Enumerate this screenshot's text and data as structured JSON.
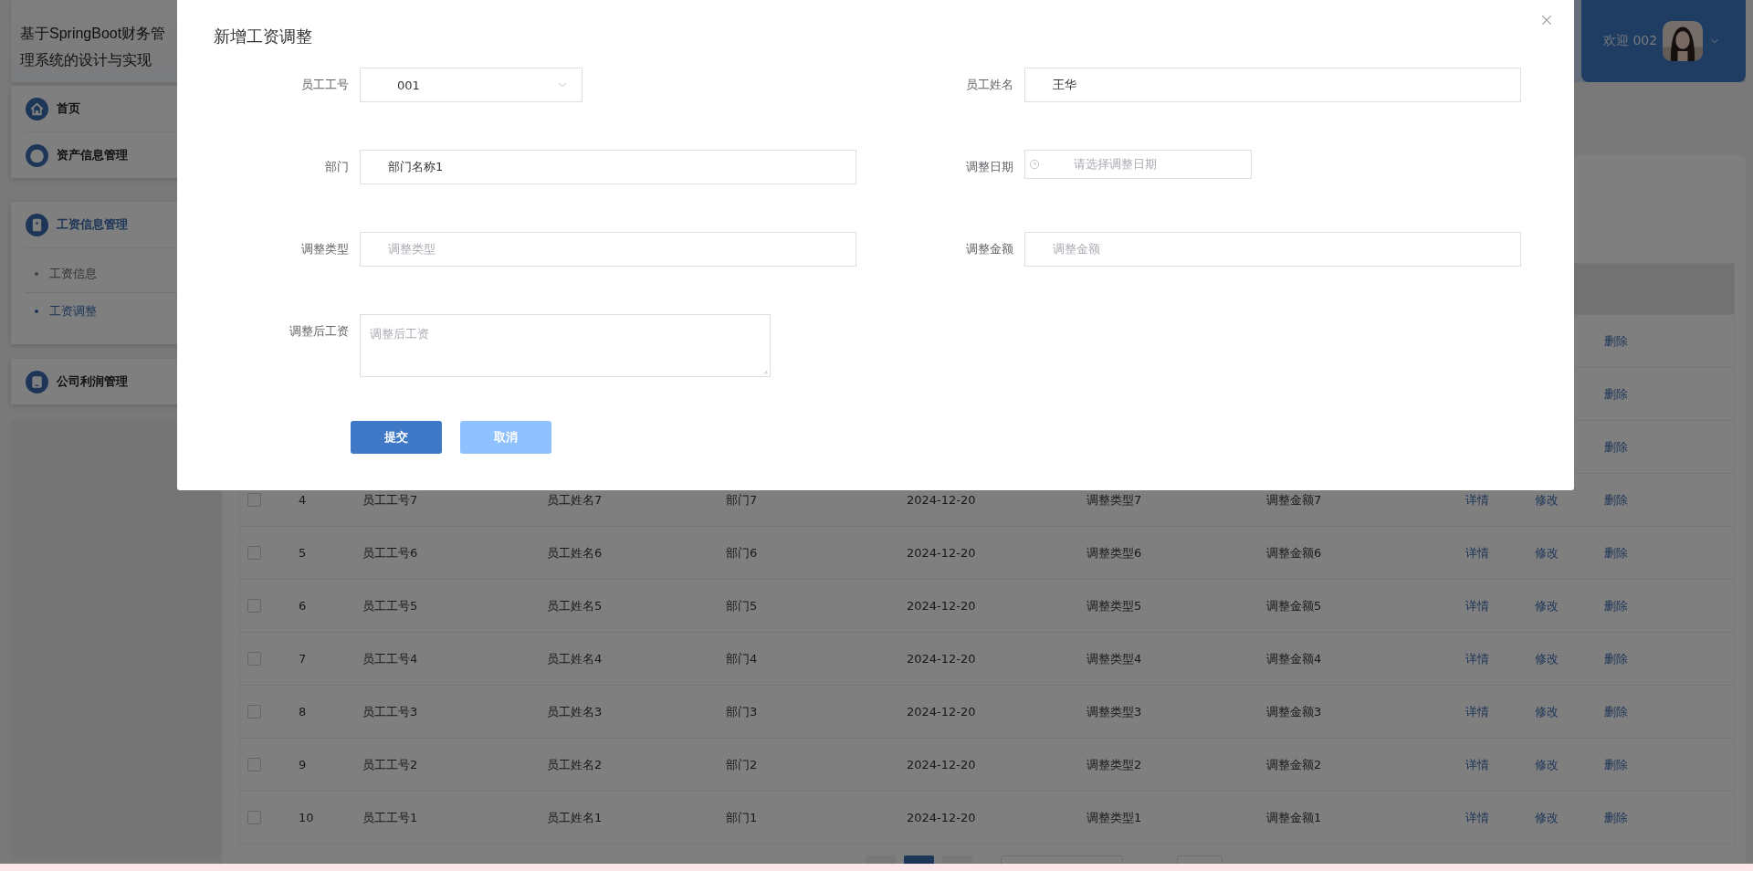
{
  "app": {
    "title": "基于SpringBoot财务管理系统的设计与实现"
  },
  "user": {
    "greeting": "欢迎 002"
  },
  "sidebar": {
    "groups": [
      {
        "items": [
          {
            "label": "首页",
            "active": false
          },
          {
            "label": "资产信息管理",
            "active": false
          }
        ]
      },
      {
        "items": [
          {
            "label": "工资信息管理",
            "active": true,
            "children": [
              {
                "label": "工资信息",
                "selected": false
              },
              {
                "label": "工资调整",
                "selected": true
              }
            ]
          }
        ]
      },
      {
        "items": [
          {
            "label": "公司利润管理",
            "active": false
          }
        ]
      }
    ]
  },
  "table": {
    "rows": [
      {
        "actions": [
          {
            "kind": "delete",
            "label": "删除"
          }
        ]
      },
      {
        "actions": [
          {
            "kind": "delete",
            "label": "删除"
          }
        ]
      },
      {
        "actions": [
          {
            "kind": "delete",
            "label": "删除"
          }
        ]
      },
      {
        "checked": false,
        "cells": [
          "4",
          "员工工号7",
          "员工姓名7",
          "部门7",
          "2024-12-20",
          "调整类型7",
          "调整金额7"
        ],
        "actions": [
          {
            "kind": "detail",
            "label": "详情"
          },
          {
            "kind": "edit",
            "label": "修改"
          },
          {
            "kind": "delete",
            "label": "删除"
          }
        ]
      },
      {
        "checked": false,
        "cells": [
          "5",
          "员工工号6",
          "员工姓名6",
          "部门6",
          "2024-12-20",
          "调整类型6",
          "调整金额6"
        ],
        "actions": [
          {
            "kind": "detail",
            "label": "详情"
          },
          {
            "kind": "edit",
            "label": "修改"
          },
          {
            "kind": "delete",
            "label": "删除"
          }
        ]
      },
      {
        "checked": false,
        "cells": [
          "6",
          "员工工号5",
          "员工姓名5",
          "部门5",
          "2024-12-20",
          "调整类型5",
          "调整金额5"
        ],
        "actions": [
          {
            "kind": "detail",
            "label": "详情"
          },
          {
            "kind": "edit",
            "label": "修改"
          },
          {
            "kind": "delete",
            "label": "删除"
          }
        ]
      },
      {
        "checked": false,
        "cells": [
          "7",
          "员工工号4",
          "员工姓名4",
          "部门4",
          "2024-12-20",
          "调整类型4",
          "调整金额4"
        ],
        "actions": [
          {
            "kind": "detail",
            "label": "详情"
          },
          {
            "kind": "edit",
            "label": "修改"
          },
          {
            "kind": "delete",
            "label": "删除"
          }
        ]
      },
      {
        "checked": false,
        "cells": [
          "8",
          "员工工号3",
          "员工姓名3",
          "部门3",
          "2024-12-20",
          "调整类型3",
          "调整金额3"
        ],
        "actions": [
          {
            "kind": "detail",
            "label": "详情"
          },
          {
            "kind": "edit",
            "label": "修改"
          },
          {
            "kind": "delete",
            "label": "删除"
          }
        ]
      },
      {
        "checked": false,
        "cells": [
          "9",
          "员工工号2",
          "员工姓名2",
          "部门2",
          "2024-12-20",
          "调整类型2",
          "调整金额2"
        ],
        "actions": [
          {
            "kind": "detail",
            "label": "详情"
          },
          {
            "kind": "edit",
            "label": "修改"
          },
          {
            "kind": "delete",
            "label": "删除"
          }
        ]
      },
      {
        "checked": false,
        "cells": [
          "10",
          "员工工号1",
          "员工姓名1",
          "部门1",
          "2024-12-20",
          "调整类型1",
          "调整金额1"
        ],
        "actions": [
          {
            "kind": "detail",
            "label": "详情"
          },
          {
            "kind": "edit",
            "label": "修改"
          },
          {
            "kind": "delete",
            "label": "删除"
          }
        ]
      }
    ]
  },
  "pagination": {
    "pages": [
      {
        "selected": false
      },
      {
        "selected": true
      },
      {
        "selected": false
      }
    ]
  },
  "dialog": {
    "title": "新增工资调整",
    "fields": [
      {
        "kind": "select",
        "label": "员工工号",
        "value": "001"
      },
      {
        "kind": "input",
        "label": "员工姓名",
        "value": "王华"
      },
      {
        "kind": "input",
        "label": "部门",
        "value": "部门名称1"
      },
      {
        "kind": "date",
        "label": "调整日期",
        "placeholder": "请选择调整日期"
      },
      {
        "kind": "input",
        "label": "调整类型",
        "placeholder": "调整类型"
      },
      {
        "kind": "input",
        "label": "调整金额",
        "placeholder": "调整金额"
      },
      {
        "kind": "textarea",
        "label": "调整后工资",
        "placeholder": "调整后工资"
      }
    ],
    "buttons": [
      {
        "kind": "primary",
        "label": "提交"
      },
      {
        "kind": "secondary",
        "label": "取消"
      }
    ]
  }
}
